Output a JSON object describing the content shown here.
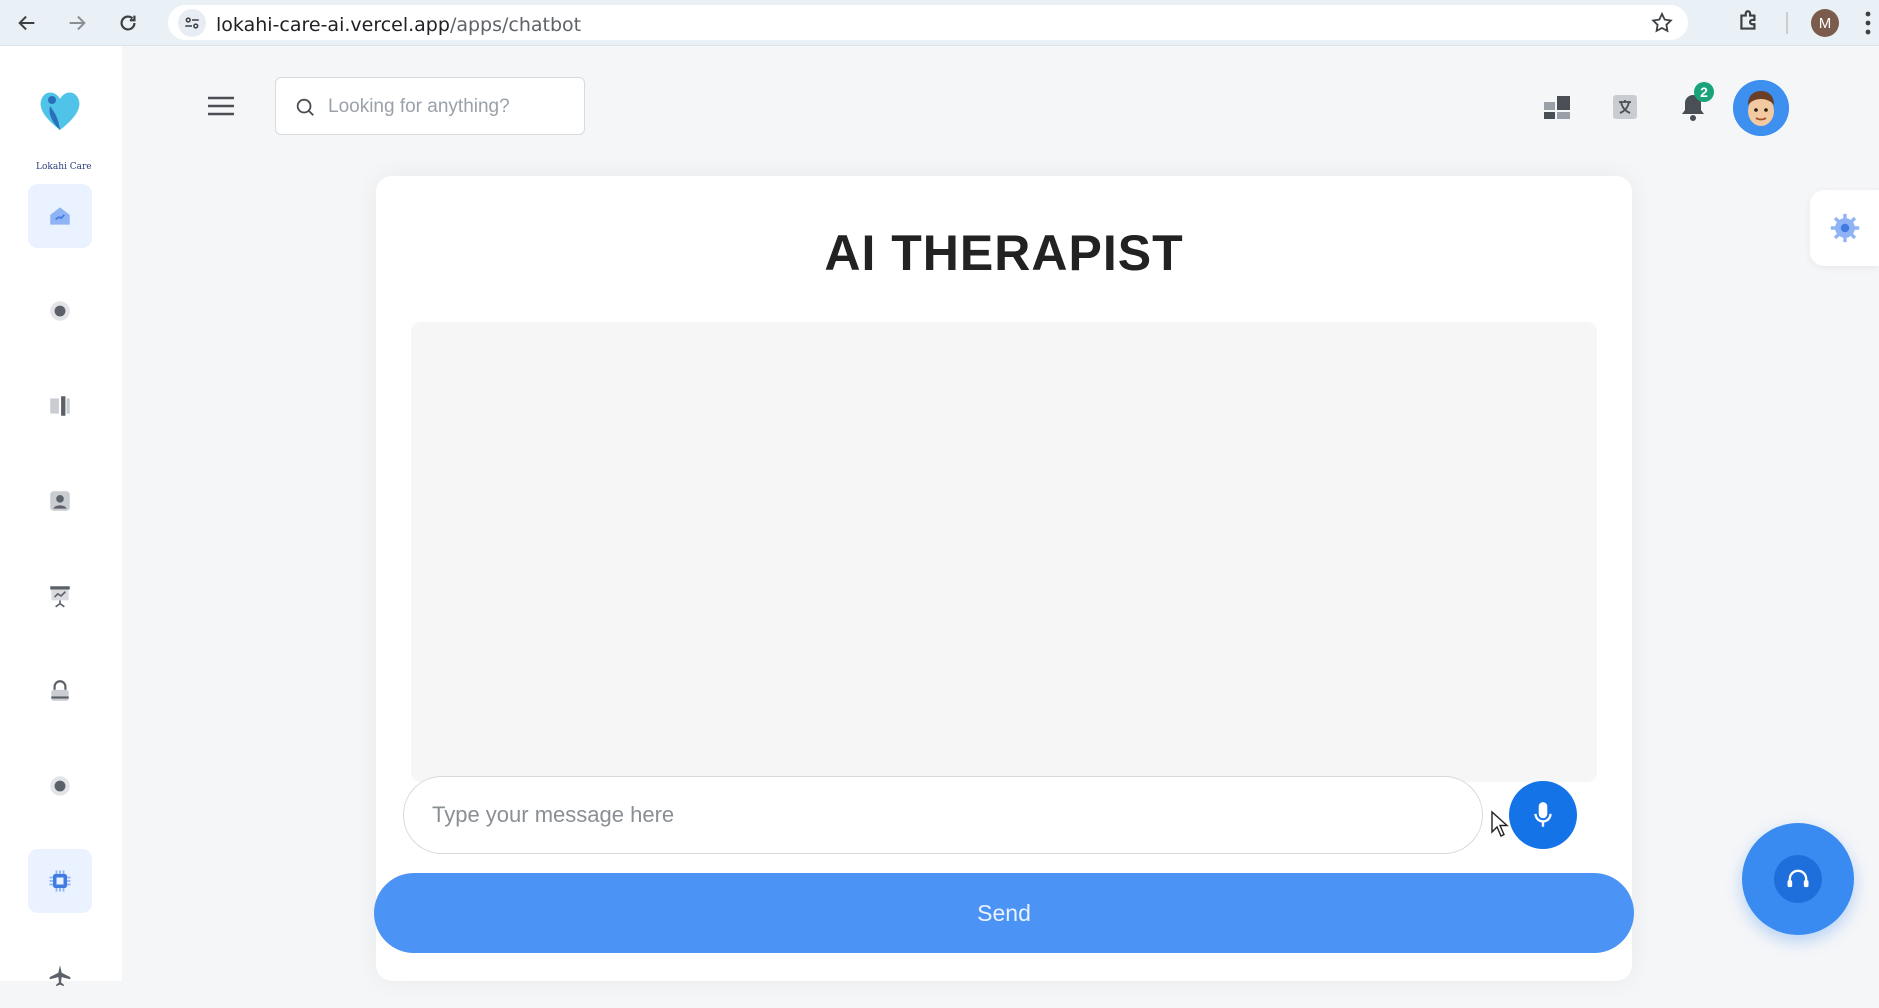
{
  "browser": {
    "url_host": "lokahi-care-ai.vercel.app",
    "url_path": "/apps/chatbot",
    "profile_initial": "M"
  },
  "brand": {
    "logo_text": "Lokahi Care",
    "accent": "#4b93f5",
    "primary": "#1473e6",
    "badge_color": "#1aa37a"
  },
  "header": {
    "search_placeholder": "Looking for anything?",
    "notification_count": "2"
  },
  "sidebar": {
    "items": [
      {
        "icon": "dashboard-icon",
        "active": true
      },
      {
        "icon": "circle-dot-icon",
        "active": false
      },
      {
        "icon": "columns-icon",
        "active": false
      },
      {
        "icon": "contact-icon",
        "active": false
      },
      {
        "icon": "presentation-icon",
        "active": false
      },
      {
        "icon": "lock-icon",
        "active": false
      },
      {
        "icon": "circle-dot-icon",
        "active": false
      },
      {
        "icon": "chip-icon",
        "active": false
      },
      {
        "icon": "airplane-icon",
        "active": false
      }
    ]
  },
  "main": {
    "title": "AI THERAPIST",
    "message_placeholder": "Type your message here",
    "send_label": "Send"
  }
}
